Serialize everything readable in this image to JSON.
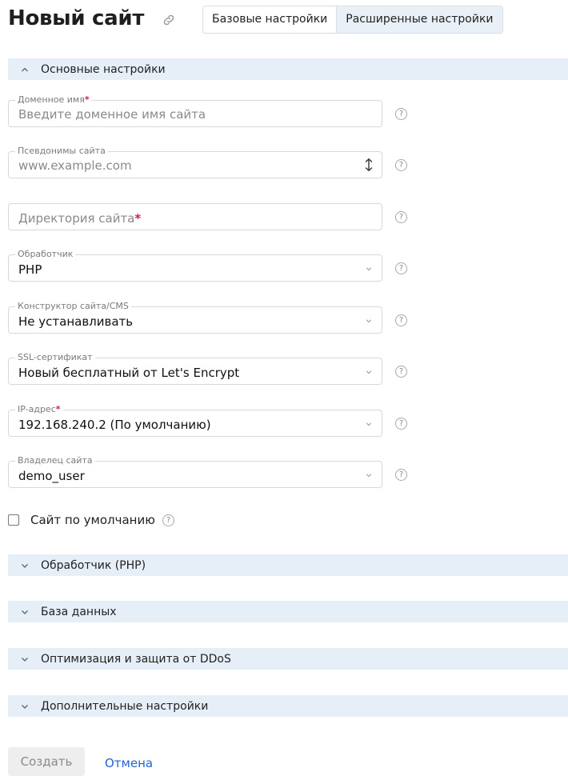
{
  "header": {
    "title": "Новый сайт",
    "link_icon": "link-icon",
    "modes": [
      {
        "label": "Базовые настройки",
        "active": false
      },
      {
        "label": "Расширенные настройки",
        "active": true
      }
    ]
  },
  "main_section": {
    "label": "Основные настройки",
    "expanded": true,
    "fields": {
      "domain": {
        "label": "Доменное имя",
        "required": "*",
        "placeholder": "Введите доменное имя сайта"
      },
      "aliases": {
        "label": "Псевдонимы сайта",
        "placeholder": "www.example.com"
      },
      "directory": {
        "placeholder": "Директория сайта",
        "required": "*"
      },
      "handler": {
        "label": "Обработчик",
        "value": "PHP"
      },
      "cms": {
        "label": "Конструктор сайта/CMS",
        "value": "Не устанавливать"
      },
      "ssl": {
        "label": "SSL-сертификат",
        "value": "Новый бесплатный от Let's Encrypt"
      },
      "ip": {
        "label": "IP-адрес",
        "required": "*",
        "value": "192.168.240.2 (По умолчанию)"
      },
      "owner": {
        "label": "Владелец сайта",
        "value": "demo_user"
      }
    },
    "help_glyph": "?",
    "default_site": {
      "label": "Сайт по умолчанию",
      "checked": false
    }
  },
  "collapsed_sections": [
    {
      "label": "Обработчик (PHP)"
    },
    {
      "label": "База данных"
    },
    {
      "label": "Оптимизация и защита от DDoS"
    },
    {
      "label": "Дополнительные настройки"
    }
  ],
  "actions": {
    "create": "Создать",
    "cancel": "Отмена"
  },
  "colors": {
    "section_bg": "#e6eef8",
    "active_mode_bg": "#e9f0f8",
    "required": "#d21c45",
    "link": "#1f63d6",
    "button_bg": "#eeeeee"
  }
}
